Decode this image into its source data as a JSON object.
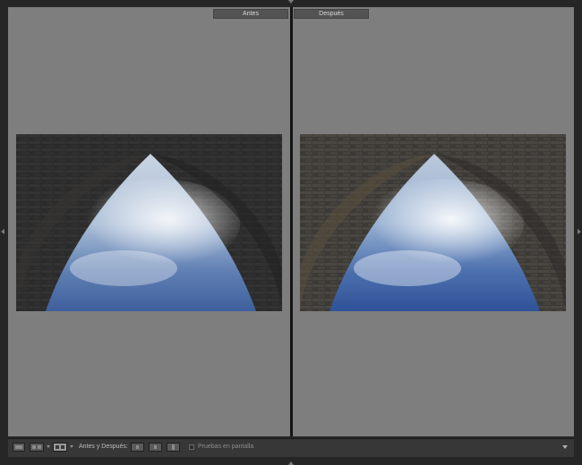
{
  "panes": {
    "before_label": "Antes",
    "after_label": "Después"
  },
  "toolbar": {
    "view_modes": [
      "loupe-view",
      "compare-view",
      "before-after-view"
    ],
    "before_after_label": "Antes y Después:",
    "actions": [
      "copy-before-to-after",
      "copy-after-to-before",
      "swap-before-after"
    ],
    "soft_proofing_label": "Pruebas en pantalla",
    "soft_proofing_checked": false
  },
  "colors": {
    "background": "#7e7e7e",
    "label_bg": "#535353",
    "toolbar_bg": "#373737"
  }
}
